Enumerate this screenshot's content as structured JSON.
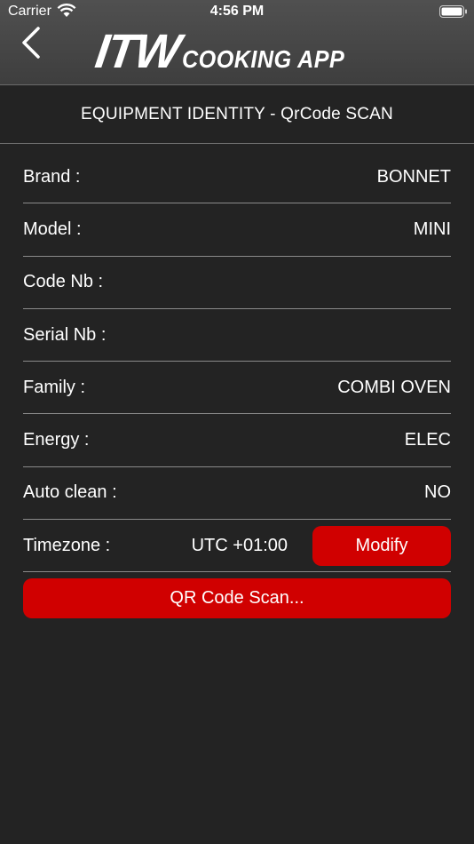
{
  "status_bar": {
    "carrier": "Carrier",
    "time": "4:56 PM"
  },
  "header": {
    "logo_main": "ITW",
    "logo_sub": "COOKING APP"
  },
  "page": {
    "title": "EQUIPMENT IDENTITY - QrCode SCAN"
  },
  "fields": [
    {
      "label": "Brand :",
      "value": "BONNET"
    },
    {
      "label": "Model :",
      "value": "MINI"
    },
    {
      "label": "Code Nb :",
      "value": ""
    },
    {
      "label": "Serial Nb :",
      "value": ""
    },
    {
      "label": "Family :",
      "value": "COMBI OVEN"
    },
    {
      "label": "Energy :",
      "value": "ELEC"
    },
    {
      "label": "Auto clean :",
      "value": "NO"
    }
  ],
  "timezone": {
    "label": "Timezone :",
    "value": "UTC +01:00",
    "modify_label": "Modify"
  },
  "actions": {
    "qr_scan_label": "QR Code Scan..."
  },
  "colors": {
    "accent": "#d00000",
    "background": "#232323",
    "header": "#474747"
  },
  "icons": [
    "wifi-icon",
    "battery-icon",
    "back-chevron-icon"
  ]
}
